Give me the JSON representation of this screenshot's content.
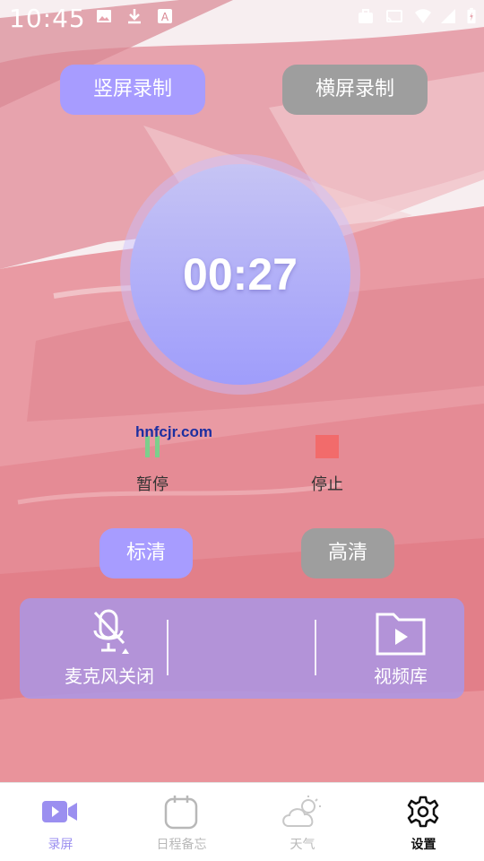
{
  "status_bar": {
    "time": "10:45",
    "icons": [
      "image-icon",
      "download-icon",
      "a-notification-icon",
      "briefcase-icon",
      "cast-icon",
      "wifi-icon",
      "signal-icon",
      "battery-charging-icon"
    ]
  },
  "mode_buttons": {
    "portrait_label": "竖屏录制",
    "landscape_label": "横屏录制",
    "selected": "portrait"
  },
  "timer": {
    "elapsed": "00:27"
  },
  "watermark": "hnfcjr.com",
  "controls": {
    "pause_label": "暂停",
    "stop_label": "停止"
  },
  "quality": {
    "standard_label": "标清",
    "hd_label": "高清",
    "selected": "standard"
  },
  "panel": {
    "mic_label": "麦克风关闭",
    "library_label": "视频库"
  },
  "bottom_nav": {
    "items": [
      {
        "label": "录屏",
        "icon": "video-camera-icon",
        "active": true
      },
      {
        "label": "日程备忘",
        "icon": "calendar-icon",
        "active": false
      },
      {
        "label": "天气",
        "icon": "weather-icon",
        "active": false
      },
      {
        "label": "设置",
        "icon": "gear-icon",
        "active": false
      }
    ]
  },
  "colors": {
    "accent": "#a79cff",
    "inactive": "#9e9e9e",
    "stop_red": "#f26b6b",
    "pause_green": "#7ccf8c",
    "panel": "#aa96e6",
    "nav_active": "#9b8ff0",
    "nav_inactive": "#b8b8b8"
  }
}
